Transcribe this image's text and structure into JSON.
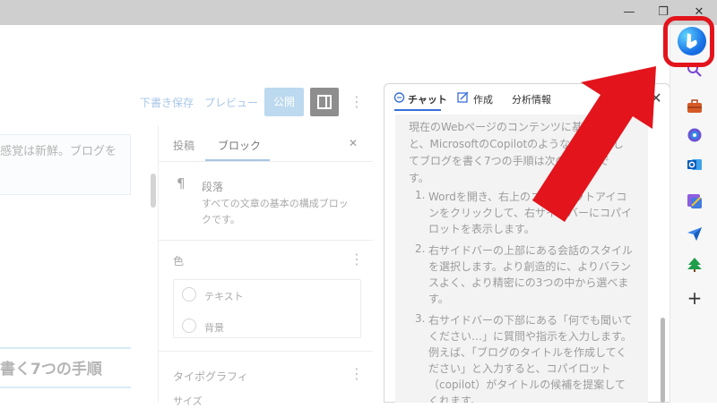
{
  "window": {
    "minimize": "—",
    "restore": "❐",
    "close": "✕"
  },
  "editor": {
    "toolbar": {
      "save_draft": "下書き保存",
      "preview": "プレビュー",
      "publish": "公開",
      "more": "⋮"
    },
    "paragraph_text": "感覚は新鮮。ブログを",
    "heading_text": "書く7つの手順"
  },
  "settings": {
    "tabs": [
      "投稿",
      "ブロック"
    ],
    "close": "✕",
    "block": {
      "icon": "¶",
      "name": "段落",
      "description": "すべての文章の基本の構成ブロックです。"
    },
    "color": {
      "title": "色",
      "options": [
        "テキスト",
        "背景"
      ]
    },
    "typography": {
      "title": "タイポグラフィ",
      "size_label": "サイズ"
    }
  },
  "copilot": {
    "tabs": [
      "チャット",
      "作成",
      "分析情報"
    ],
    "close": "✕",
    "intro": "現在のWebページのコンテンツに基づくと、MicrosoftのCopilotのようなAIを使用してブログを書く7つの手順は次のとおりです。",
    "steps": [
      {
        "num": "1.",
        "text": "Wordを開き、右上のコパイロットアイコンをクリックして、右サイドバーにコパイロットを表示します。"
      },
      {
        "num": "2.",
        "text": "右サイドバーの上部にある会話のスタイルを選択します。より創造的に、よりバランスよく、より精密にの3つの中から選べます。"
      },
      {
        "num": "3.",
        "text": "右サイドバーの下部にある「何でも聞いてください…」に質問や指示を入力します。例えば、「ブログのタイトルを作成してください」と入力すると、コパイロット（copilot）がタイトルの候補を提案してくれます。"
      }
    ]
  },
  "sidebar_icons": [
    "search-icon",
    "briefcase-icon",
    "office-icon",
    "outlook-icon",
    "designer-icon",
    "send-icon",
    "tree-icon",
    "add-icon"
  ],
  "colors": {
    "highlight": "#e3141c",
    "copilot_accent": "#3a6fd8"
  }
}
